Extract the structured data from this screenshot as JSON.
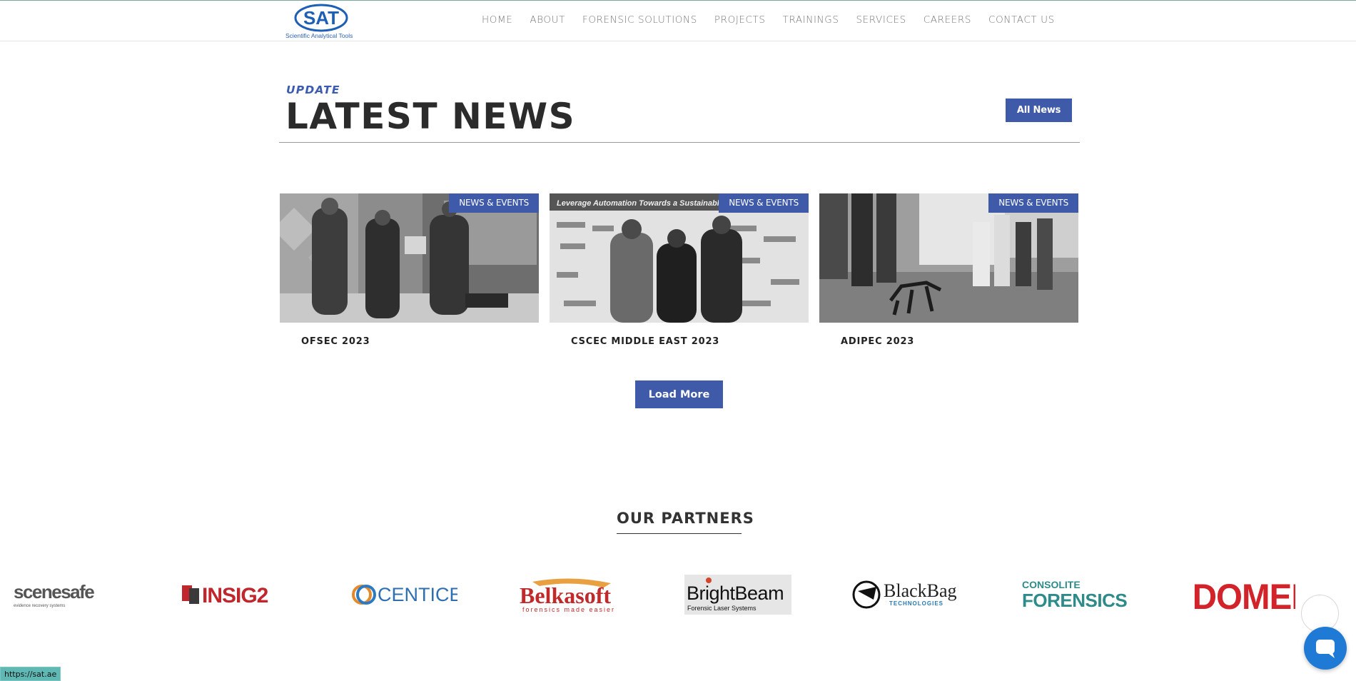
{
  "header": {
    "logo_acronym": "SAT",
    "logo_tagline": "Scientific Analytical Tools",
    "nav": [
      {
        "label": "HOME"
      },
      {
        "label": "ABOUT"
      },
      {
        "label": "FORENSIC SOLUTIONS"
      },
      {
        "label": "PROJECTS"
      },
      {
        "label": "TRAININGS"
      },
      {
        "label": "SERVICES"
      },
      {
        "label": "CAREERS"
      },
      {
        "label": "CONTACT US"
      }
    ]
  },
  "news": {
    "kicker": "UPDATE",
    "title": "LATEST NEWS",
    "all_news_label": "All News",
    "cards": [
      {
        "badge": "NEWS & EVENTS",
        "title": "OFSEC 2023"
      },
      {
        "badge": "NEWS & EVENTS",
        "title": "CSCEC MIDDLE EAST 2023",
        "banner_text": "Leverage Automation Towards a Sustainable Cons"
      },
      {
        "badge": "NEWS & EVENTS",
        "title": "ADIPEC 2023"
      }
    ],
    "load_more_label": "Load More"
  },
  "partners": {
    "title": "OUR PARTNERS",
    "logos": [
      {
        "name": "scenesafe",
        "sub": "evidence recovery systems"
      },
      {
        "name": "INSIG2"
      },
      {
        "name": "CENTICE"
      },
      {
        "name": "Belkasoft",
        "sub": "forensics made easier"
      },
      {
        "name": "BrightBeam",
        "sub": "Forensic Laser Systems"
      },
      {
        "name": "BlackBag",
        "sub": "TECHNOLOGIES"
      },
      {
        "name": "CONSOLITE",
        "sub": "FORENSICS"
      },
      {
        "name": "DOMEL"
      }
    ]
  },
  "status_bar": {
    "url": "https://sat.ae"
  },
  "colors": {
    "accent": "#3e5aa8",
    "chat": "#1f7ad6",
    "status": "#5fb8b3"
  }
}
